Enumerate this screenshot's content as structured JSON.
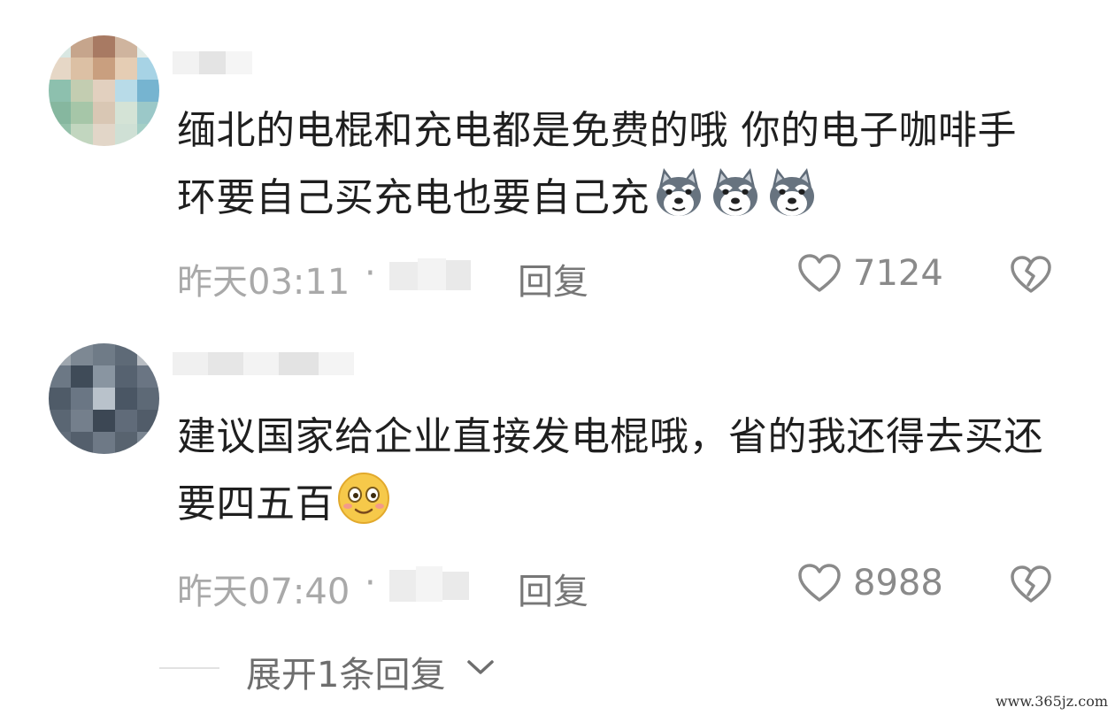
{
  "comments": [
    {
      "text": "缅北的电棍和充电都是免费的哦  你的电子咖啡手环要自己买充电也要自己充",
      "emojis": [
        "husky-emoji",
        "husky-emoji",
        "husky-emoji"
      ],
      "time": "昨天03:11",
      "separator": "·",
      "reply_label": "回复",
      "likes": "7124"
    },
    {
      "text": "建议国家给企业直接发电棍哦，省的我还得去买还要四五百",
      "emojis": [
        "blushing-smile-emoji"
      ],
      "time": "昨天07:40",
      "separator": "·",
      "reply_label": "回复",
      "likes": "8988"
    }
  ],
  "expand_replies": {
    "label": "展开1条回复",
    "icon": "chevron-down-icon"
  },
  "watermark": "www.365jz.com",
  "colors": {
    "text": "#1f1f1f",
    "meta": "#a9a9a9",
    "reply": "#777777",
    "icon": "#8a8a8a",
    "emoji_yellow": "#f6c94a"
  }
}
